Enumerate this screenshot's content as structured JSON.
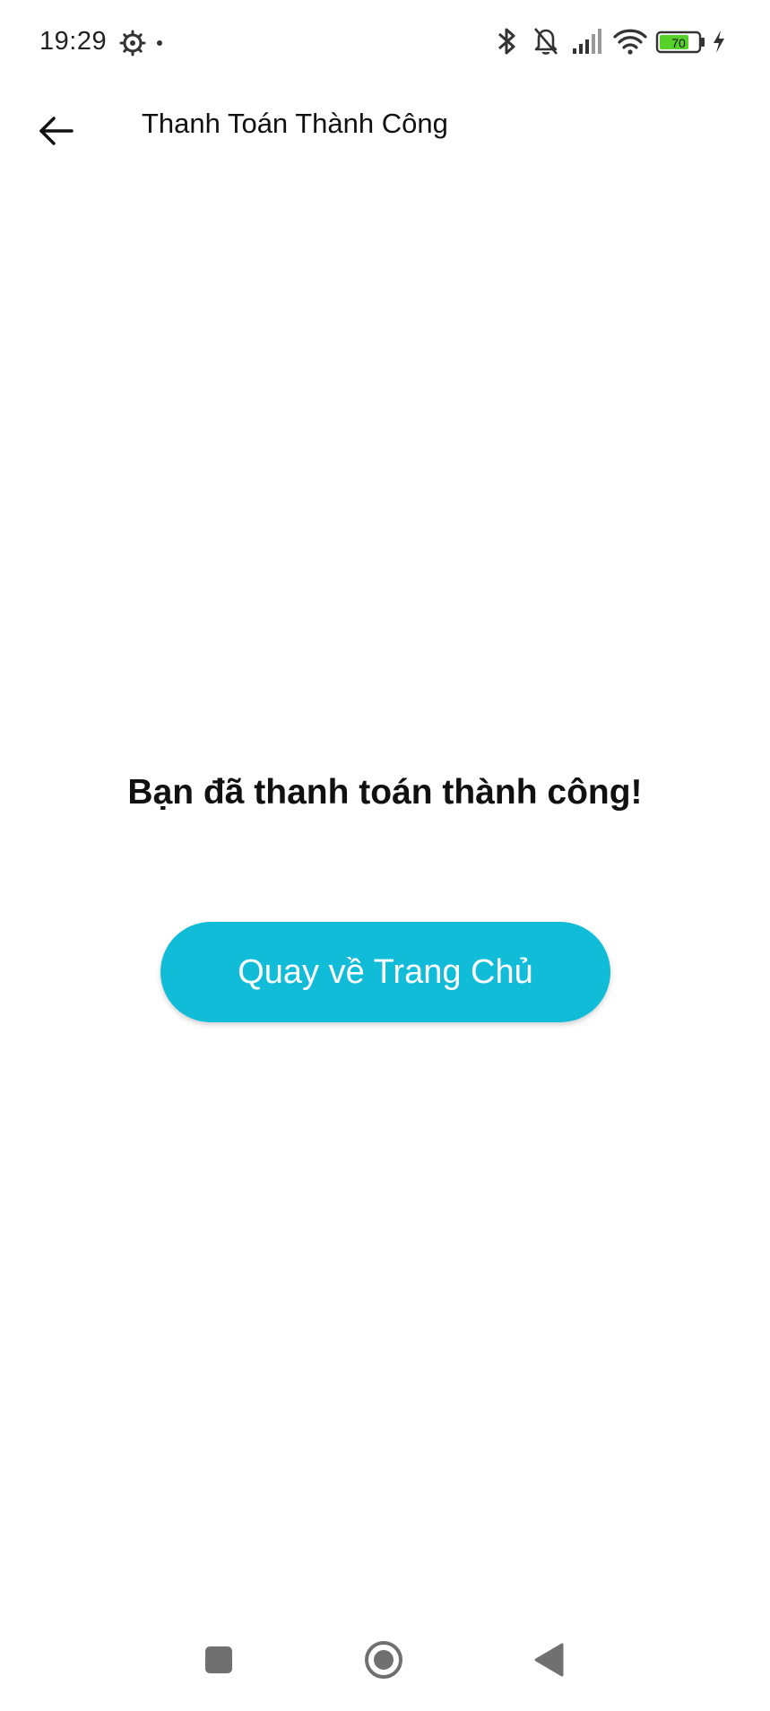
{
  "status_bar": {
    "time": "19:29",
    "battery_level": "70",
    "icons": [
      "settings-icon",
      "bluetooth-icon",
      "mute-bell-icon",
      "signal-icon",
      "wifi-icon",
      "battery-icon",
      "charging-icon"
    ]
  },
  "app_bar": {
    "title": "Thanh Toán Thành Công",
    "back_icon": "back-arrow-icon"
  },
  "main": {
    "message": "Bạn đã thanh toán thành công!",
    "home_button_label": "Quay về Trang Chủ"
  },
  "colors": {
    "accent": "#11bcd9",
    "battery_green": "#55d12a",
    "text": "#111111",
    "nav_gray": "#707070"
  },
  "nav_bar": {
    "icons": [
      "recents-icon",
      "home-icon",
      "back-icon"
    ]
  }
}
